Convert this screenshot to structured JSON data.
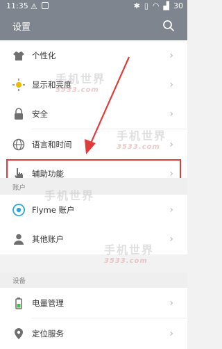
{
  "status": {
    "time": "11:35",
    "battery": "30"
  },
  "header": {
    "title": "设置"
  },
  "items": [
    {
      "label": "个性化",
      "icon": "shirt-icon"
    },
    {
      "label": "显示和亮度",
      "icon": "brightness-icon"
    },
    {
      "label": "安全",
      "icon": "lock-icon"
    },
    {
      "label": "语言和时间",
      "icon": "globe-icon"
    },
    {
      "label": "辅助功能",
      "icon": "hand-icon"
    }
  ],
  "sections": {
    "account": "账户",
    "device": "设备"
  },
  "account_items": [
    {
      "label": "Flyme 账户",
      "icon": "flyme-icon"
    },
    {
      "label": "其他账户",
      "icon": "person-icon"
    }
  ],
  "device_items": [
    {
      "label": "电量管理",
      "icon": "battery-icon"
    },
    {
      "label": "定位服务",
      "icon": "location-icon"
    }
  ],
  "watermark": {
    "text": "手机世界",
    "sub": "3533.com"
  },
  "colors": {
    "header": "#7f858f",
    "highlight": "#e23b3b"
  }
}
